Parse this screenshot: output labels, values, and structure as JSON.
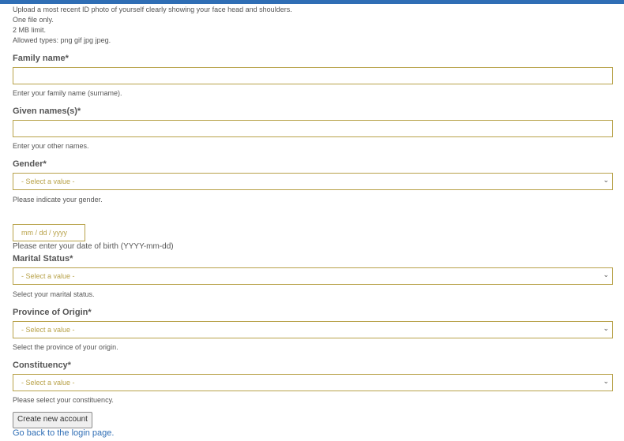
{
  "upload_info": {
    "line1": "Upload a most recent ID photo of yourself clearly showing your face head and shoulders.",
    "line2": "One file only.",
    "line3": "2 MB limit.",
    "line4": "Allowed types: png gif jpg jpeg."
  },
  "family_name": {
    "label": "Family name*",
    "value": "",
    "help": "Enter your family name (surname)."
  },
  "given_names": {
    "label": "Given names(s)*",
    "value": "",
    "help": "Enter your other names."
  },
  "gender": {
    "label": "Gender*",
    "selected": "- Select a value -",
    "help": "Please indicate your gender."
  },
  "date_of_birth": {
    "placeholder": "mm / dd / yyyy",
    "help": "Please enter your date of birth (YYYY-mm-dd)"
  },
  "marital_status": {
    "label": "Marital Status*",
    "selected": "- Select a value -",
    "help": "Select your marital status."
  },
  "province": {
    "label": "Province of Origin*",
    "selected": "- Select a value -",
    "help": "Select the province of your origin."
  },
  "constituency": {
    "label": "Constituency*",
    "selected": "- Select a value -",
    "help": "Please select your constituency."
  },
  "actions": {
    "submit_label": "Create new account",
    "login_link": "Go back to the login page."
  },
  "colors": {
    "accent_blue": "#2f6eb5",
    "field_border": "#b8a24a"
  },
  "icons": {
    "select_chevron": "chevron-down-icon"
  }
}
